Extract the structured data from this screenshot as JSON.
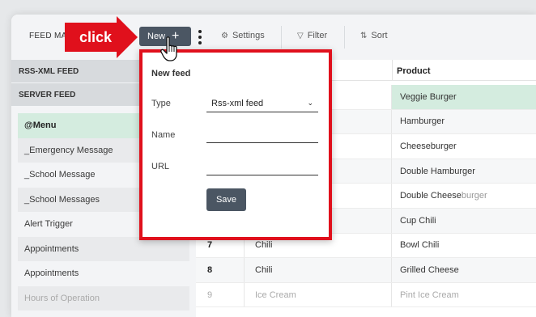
{
  "toolbar": {
    "title": "FEED MA",
    "new_label": "New",
    "new_icon": "+",
    "settings_label": "Settings",
    "settings_icon": "gear-icon",
    "filter_label": "Filter",
    "filter_icon": "funnel-icon",
    "sort_label": "Sort",
    "sort_icon": "sort-arrows-icon"
  },
  "annotation": {
    "click_label": "click",
    "arrow_color": "#e0101c"
  },
  "sidebar": {
    "sections": [
      "RSS-XML FEED",
      "SERVER FEED"
    ],
    "items": [
      {
        "label": "@Menu",
        "state": "active"
      },
      {
        "label": "_Emergency Message",
        "state": ""
      },
      {
        "label": "_School Message",
        "state": ""
      },
      {
        "label": "_School Messages",
        "state": ""
      },
      {
        "label": "Alert Trigger",
        "state": ""
      },
      {
        "label": "Appointments",
        "state": ""
      },
      {
        "label": "Appointments",
        "state": ""
      },
      {
        "label": "Hours of Operation",
        "state": "faded"
      }
    ]
  },
  "grid": {
    "columns": {
      "product": "Product"
    },
    "rows": [
      {
        "num": "",
        "item": "",
        "product": "Veggie Burger",
        "product_dim": "",
        "state": "selected"
      },
      {
        "num": "",
        "item": "",
        "product": "Hamburger",
        "product_dim": "",
        "state": ""
      },
      {
        "num": "",
        "item": "",
        "product": "Cheeseburger",
        "product_dim": "",
        "state": ""
      },
      {
        "num": "",
        "item": "",
        "product": "Double Hamburger",
        "product_dim": "",
        "state": ""
      },
      {
        "num": "",
        "item": "",
        "product": "Double Cheese",
        "product_dim": "burger",
        "state": ""
      },
      {
        "num": "",
        "item": "",
        "product": "Cup Chili",
        "product_dim": "",
        "state": ""
      },
      {
        "num": "7",
        "item": "Chili",
        "product": "Bowl Chili",
        "product_dim": "",
        "state": ""
      },
      {
        "num": "8",
        "item": "Chili",
        "product": "Grilled Cheese",
        "product_dim": "",
        "state": ""
      },
      {
        "num": "9",
        "item": "Ice Cream",
        "product": "Pint Ice Cream",
        "product_dim": "",
        "state": "faded"
      }
    ]
  },
  "popup": {
    "title": "New feed",
    "type_label": "Type",
    "type_value": "Rss-xml feed",
    "name_label": "Name",
    "name_value": "",
    "url_label": "URL",
    "url_value": "",
    "save_label": "Save",
    "border_color": "#e0101c"
  },
  "colors": {
    "accent_button": "#4b5663",
    "selected_row": "#d4ecdf"
  }
}
